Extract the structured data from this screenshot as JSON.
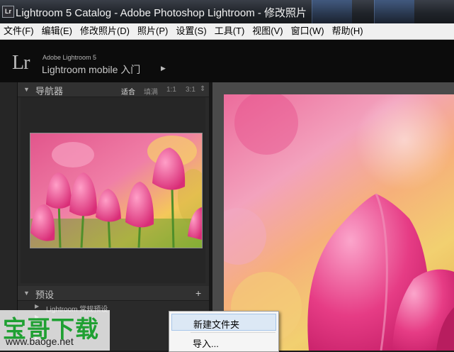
{
  "window": {
    "app_icon": "Lr",
    "title": "Lightroom 5 Catalog - Adobe Photoshop Lightroom - 修改照片"
  },
  "menu": [
    "文件(F)",
    "编辑(E)",
    "修改照片(D)",
    "照片(P)",
    "设置(S)",
    "工具(T)",
    "视图(V)",
    "窗口(W)",
    "帮助(H)"
  ],
  "identity_plate": {
    "logo": "Lr",
    "small_text": "Adobe Lightroom 5",
    "main_text": "Lightroom mobile 入门",
    "arrow": "▶"
  },
  "navigator": {
    "title": "导航器",
    "zoom_options": [
      "适合",
      "填满",
      "1:1",
      "3:1"
    ],
    "active_zoom": "适合",
    "spinner": "⇕"
  },
  "presets": {
    "title": "预设",
    "add": "+",
    "items": [
      "Lightroom 常规预设",
      "",
      "",
      ""
    ]
  },
  "context_menu": {
    "items": [
      "新建文件夹",
      "导入..."
    ],
    "highlighted_index": 0
  },
  "watermark": {
    "brand": "宝哥下载",
    "url": "www.baoge.net"
  },
  "colors": {
    "titlebar": "#1e2227",
    "menubar": "#f0f0f0",
    "panel": "#2a2a2a",
    "watermark_green": "#1fa032",
    "tulip_pink": "#e0357e"
  },
  "icons": [
    "lightroom-app-icon",
    "panel-collapse-triangle-icon",
    "add-icon",
    "zoom-spinner-icon",
    "submenu-arrow-icon"
  ]
}
